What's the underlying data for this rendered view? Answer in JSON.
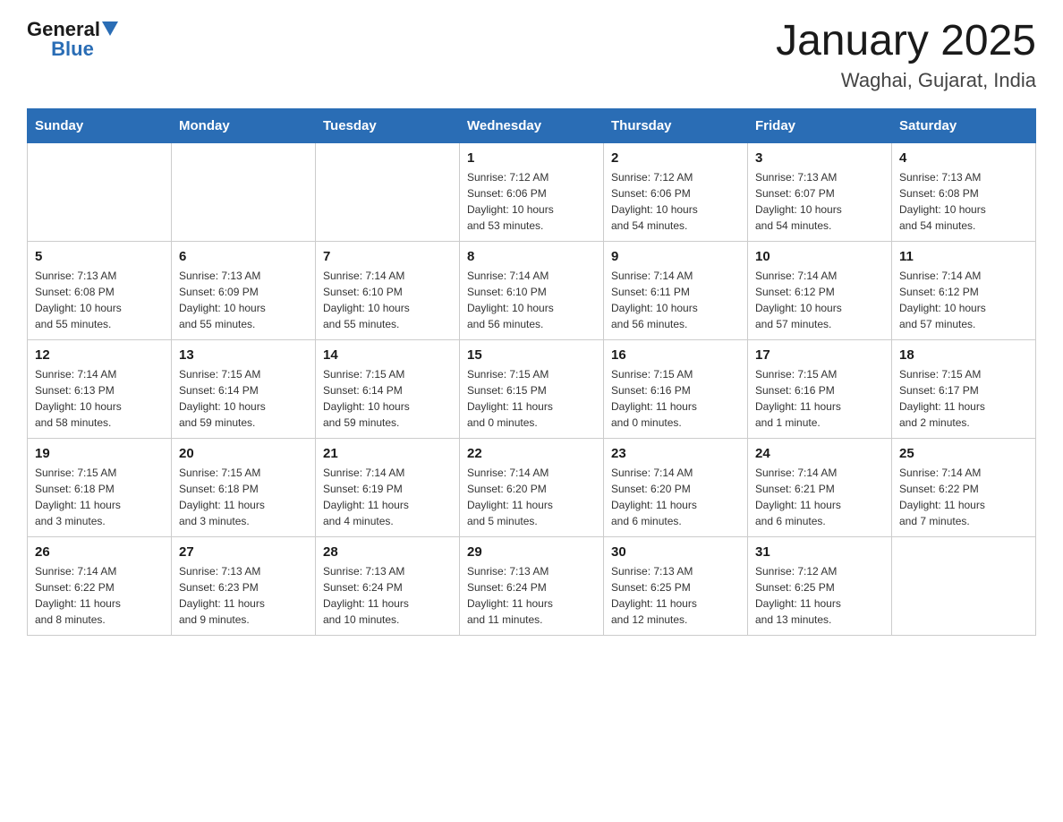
{
  "header": {
    "logo_general": "General",
    "logo_blue": "Blue",
    "title": "January 2025",
    "subtitle": "Waghai, Gujarat, India"
  },
  "days_of_week": [
    "Sunday",
    "Monday",
    "Tuesday",
    "Wednesday",
    "Thursday",
    "Friday",
    "Saturday"
  ],
  "weeks": [
    [
      {
        "day": "",
        "info": ""
      },
      {
        "day": "",
        "info": ""
      },
      {
        "day": "",
        "info": ""
      },
      {
        "day": "1",
        "info": "Sunrise: 7:12 AM\nSunset: 6:06 PM\nDaylight: 10 hours\nand 53 minutes."
      },
      {
        "day": "2",
        "info": "Sunrise: 7:12 AM\nSunset: 6:06 PM\nDaylight: 10 hours\nand 54 minutes."
      },
      {
        "day": "3",
        "info": "Sunrise: 7:13 AM\nSunset: 6:07 PM\nDaylight: 10 hours\nand 54 minutes."
      },
      {
        "day": "4",
        "info": "Sunrise: 7:13 AM\nSunset: 6:08 PM\nDaylight: 10 hours\nand 54 minutes."
      }
    ],
    [
      {
        "day": "5",
        "info": "Sunrise: 7:13 AM\nSunset: 6:08 PM\nDaylight: 10 hours\nand 55 minutes."
      },
      {
        "day": "6",
        "info": "Sunrise: 7:13 AM\nSunset: 6:09 PM\nDaylight: 10 hours\nand 55 minutes."
      },
      {
        "day": "7",
        "info": "Sunrise: 7:14 AM\nSunset: 6:10 PM\nDaylight: 10 hours\nand 55 minutes."
      },
      {
        "day": "8",
        "info": "Sunrise: 7:14 AM\nSunset: 6:10 PM\nDaylight: 10 hours\nand 56 minutes."
      },
      {
        "day": "9",
        "info": "Sunrise: 7:14 AM\nSunset: 6:11 PM\nDaylight: 10 hours\nand 56 minutes."
      },
      {
        "day": "10",
        "info": "Sunrise: 7:14 AM\nSunset: 6:12 PM\nDaylight: 10 hours\nand 57 minutes."
      },
      {
        "day": "11",
        "info": "Sunrise: 7:14 AM\nSunset: 6:12 PM\nDaylight: 10 hours\nand 57 minutes."
      }
    ],
    [
      {
        "day": "12",
        "info": "Sunrise: 7:14 AM\nSunset: 6:13 PM\nDaylight: 10 hours\nand 58 minutes."
      },
      {
        "day": "13",
        "info": "Sunrise: 7:15 AM\nSunset: 6:14 PM\nDaylight: 10 hours\nand 59 minutes."
      },
      {
        "day": "14",
        "info": "Sunrise: 7:15 AM\nSunset: 6:14 PM\nDaylight: 10 hours\nand 59 minutes."
      },
      {
        "day": "15",
        "info": "Sunrise: 7:15 AM\nSunset: 6:15 PM\nDaylight: 11 hours\nand 0 minutes."
      },
      {
        "day": "16",
        "info": "Sunrise: 7:15 AM\nSunset: 6:16 PM\nDaylight: 11 hours\nand 0 minutes."
      },
      {
        "day": "17",
        "info": "Sunrise: 7:15 AM\nSunset: 6:16 PM\nDaylight: 11 hours\nand 1 minute."
      },
      {
        "day": "18",
        "info": "Sunrise: 7:15 AM\nSunset: 6:17 PM\nDaylight: 11 hours\nand 2 minutes."
      }
    ],
    [
      {
        "day": "19",
        "info": "Sunrise: 7:15 AM\nSunset: 6:18 PM\nDaylight: 11 hours\nand 3 minutes."
      },
      {
        "day": "20",
        "info": "Sunrise: 7:15 AM\nSunset: 6:18 PM\nDaylight: 11 hours\nand 3 minutes."
      },
      {
        "day": "21",
        "info": "Sunrise: 7:14 AM\nSunset: 6:19 PM\nDaylight: 11 hours\nand 4 minutes."
      },
      {
        "day": "22",
        "info": "Sunrise: 7:14 AM\nSunset: 6:20 PM\nDaylight: 11 hours\nand 5 minutes."
      },
      {
        "day": "23",
        "info": "Sunrise: 7:14 AM\nSunset: 6:20 PM\nDaylight: 11 hours\nand 6 minutes."
      },
      {
        "day": "24",
        "info": "Sunrise: 7:14 AM\nSunset: 6:21 PM\nDaylight: 11 hours\nand 6 minutes."
      },
      {
        "day": "25",
        "info": "Sunrise: 7:14 AM\nSunset: 6:22 PM\nDaylight: 11 hours\nand 7 minutes."
      }
    ],
    [
      {
        "day": "26",
        "info": "Sunrise: 7:14 AM\nSunset: 6:22 PM\nDaylight: 11 hours\nand 8 minutes."
      },
      {
        "day": "27",
        "info": "Sunrise: 7:13 AM\nSunset: 6:23 PM\nDaylight: 11 hours\nand 9 minutes."
      },
      {
        "day": "28",
        "info": "Sunrise: 7:13 AM\nSunset: 6:24 PM\nDaylight: 11 hours\nand 10 minutes."
      },
      {
        "day": "29",
        "info": "Sunrise: 7:13 AM\nSunset: 6:24 PM\nDaylight: 11 hours\nand 11 minutes."
      },
      {
        "day": "30",
        "info": "Sunrise: 7:13 AM\nSunset: 6:25 PM\nDaylight: 11 hours\nand 12 minutes."
      },
      {
        "day": "31",
        "info": "Sunrise: 7:12 AM\nSunset: 6:25 PM\nDaylight: 11 hours\nand 13 minutes."
      },
      {
        "day": "",
        "info": ""
      }
    ]
  ]
}
